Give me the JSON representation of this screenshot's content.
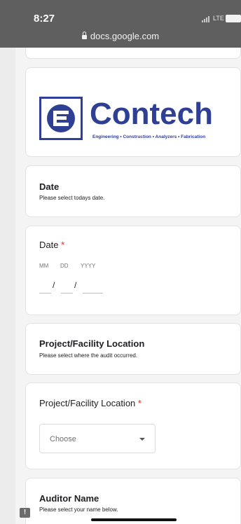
{
  "status": {
    "time": "8:27",
    "network": "LTE",
    "url": "docs.google.com"
  },
  "logo": {
    "brand": "Contech",
    "tagline": "Engineering • Construction • Analyzers • Fabrication"
  },
  "sections": {
    "date_section": {
      "title": "Date",
      "description": "Please select todays date."
    },
    "location_section": {
      "title": "Project/Facility Location",
      "description": "Please select where the audit occurred."
    },
    "auditor_section": {
      "title": "Auditor Name",
      "description": "Please select your name below."
    }
  },
  "questions": {
    "date": {
      "label": "Date",
      "required_mark": "*",
      "mm": "MM",
      "dd": "DD",
      "yyyy": "YYYY",
      "separator": "/"
    },
    "location": {
      "label": "Project/Facility Location",
      "required_mark": "*",
      "selected": "Choose"
    }
  },
  "colors": {
    "brand": "#2f3f93",
    "required": "#d93025"
  },
  "icons": {
    "feedback": "!"
  }
}
